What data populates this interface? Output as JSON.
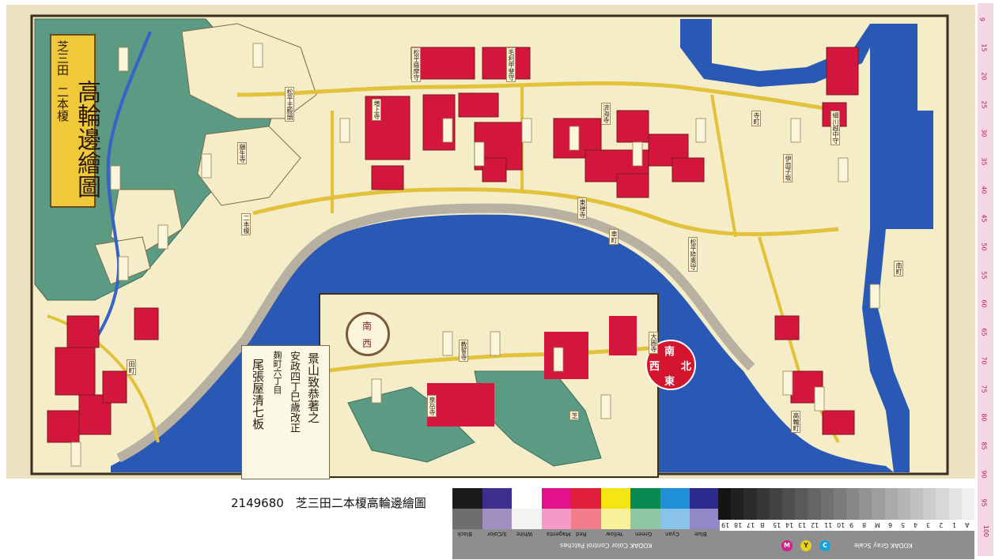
{
  "caption": "2149680　芝三田二本榎高輪邊繪圖",
  "map": {
    "title_main": "高輪邊繪圖",
    "title_right": "芝三田",
    "title_left": "二本榎",
    "compass_chars": [
      "南",
      "東",
      "北",
      "西"
    ],
    "inset_compass_chars": [
      "南",
      "西"
    ],
    "publisher_lines": [
      "景山致恭著之",
      "安政四丁巳歲改正",
      "麹町六丁目",
      "尾張屋清七板"
    ],
    "place_labels": [
      "松平薩摩守",
      "松平主殿頭",
      "毛利甲斐守",
      "細川越中守",
      "松平陸奥守",
      "増上寺",
      "泉岳寺",
      "東禅寺",
      "大圓寺",
      "願生寺",
      "済海寺",
      "教誓寺",
      "南町",
      "二本榎",
      "伊皿子坂",
      "車町",
      "高輪町",
      "田町",
      "芝",
      "寺町"
    ],
    "colors": {
      "ocean": "#2a59b5",
      "land": "#f5ecc8",
      "temple": "#d3163d",
      "field": "#5b9b83",
      "road": "#e2c23a",
      "border": "#4a3a22"
    }
  },
  "ruler": {
    "numbers": [
      "9",
      "15",
      "20",
      "25",
      "30",
      "35",
      "40",
      "45",
      "50",
      "55",
      "60",
      "65",
      "70",
      "75",
      "80",
      "85",
      "90",
      "95",
      "100"
    ]
  },
  "color_patches": {
    "title": "KODAK Color Control Patches",
    "labels": [
      "Blue",
      "Cyan",
      "Green",
      "Yellow",
      "Red",
      "Magenta",
      "White",
      "3/Color",
      "Black"
    ],
    "top_colors": [
      "#1b1b1b",
      "#3d2f8d",
      "#ffffff",
      "#e4128a",
      "#e01f3d",
      "#f5e613",
      "#0a8a53",
      "#1f8fd8",
      "#2c2a8c"
    ],
    "bottom_colors": [
      "#6e6e6e",
      "#a08fc0",
      "#f3f3f3",
      "#f49ac8",
      "#f27d8d",
      "#f8f09a",
      "#8ec7a4",
      "#8ac3ea",
      "#9288c8"
    ]
  },
  "gray_scale": {
    "title": "KODAK Gray Scale",
    "markers": [
      "A",
      "1",
      "2",
      "3",
      "4",
      "5",
      "6",
      "M",
      "8",
      "9",
      "10",
      "11",
      "12",
      "13",
      "14",
      "15",
      "B",
      "17",
      "18",
      "19"
    ],
    "cmyk": [
      "C",
      "Y",
      "M"
    ]
  }
}
